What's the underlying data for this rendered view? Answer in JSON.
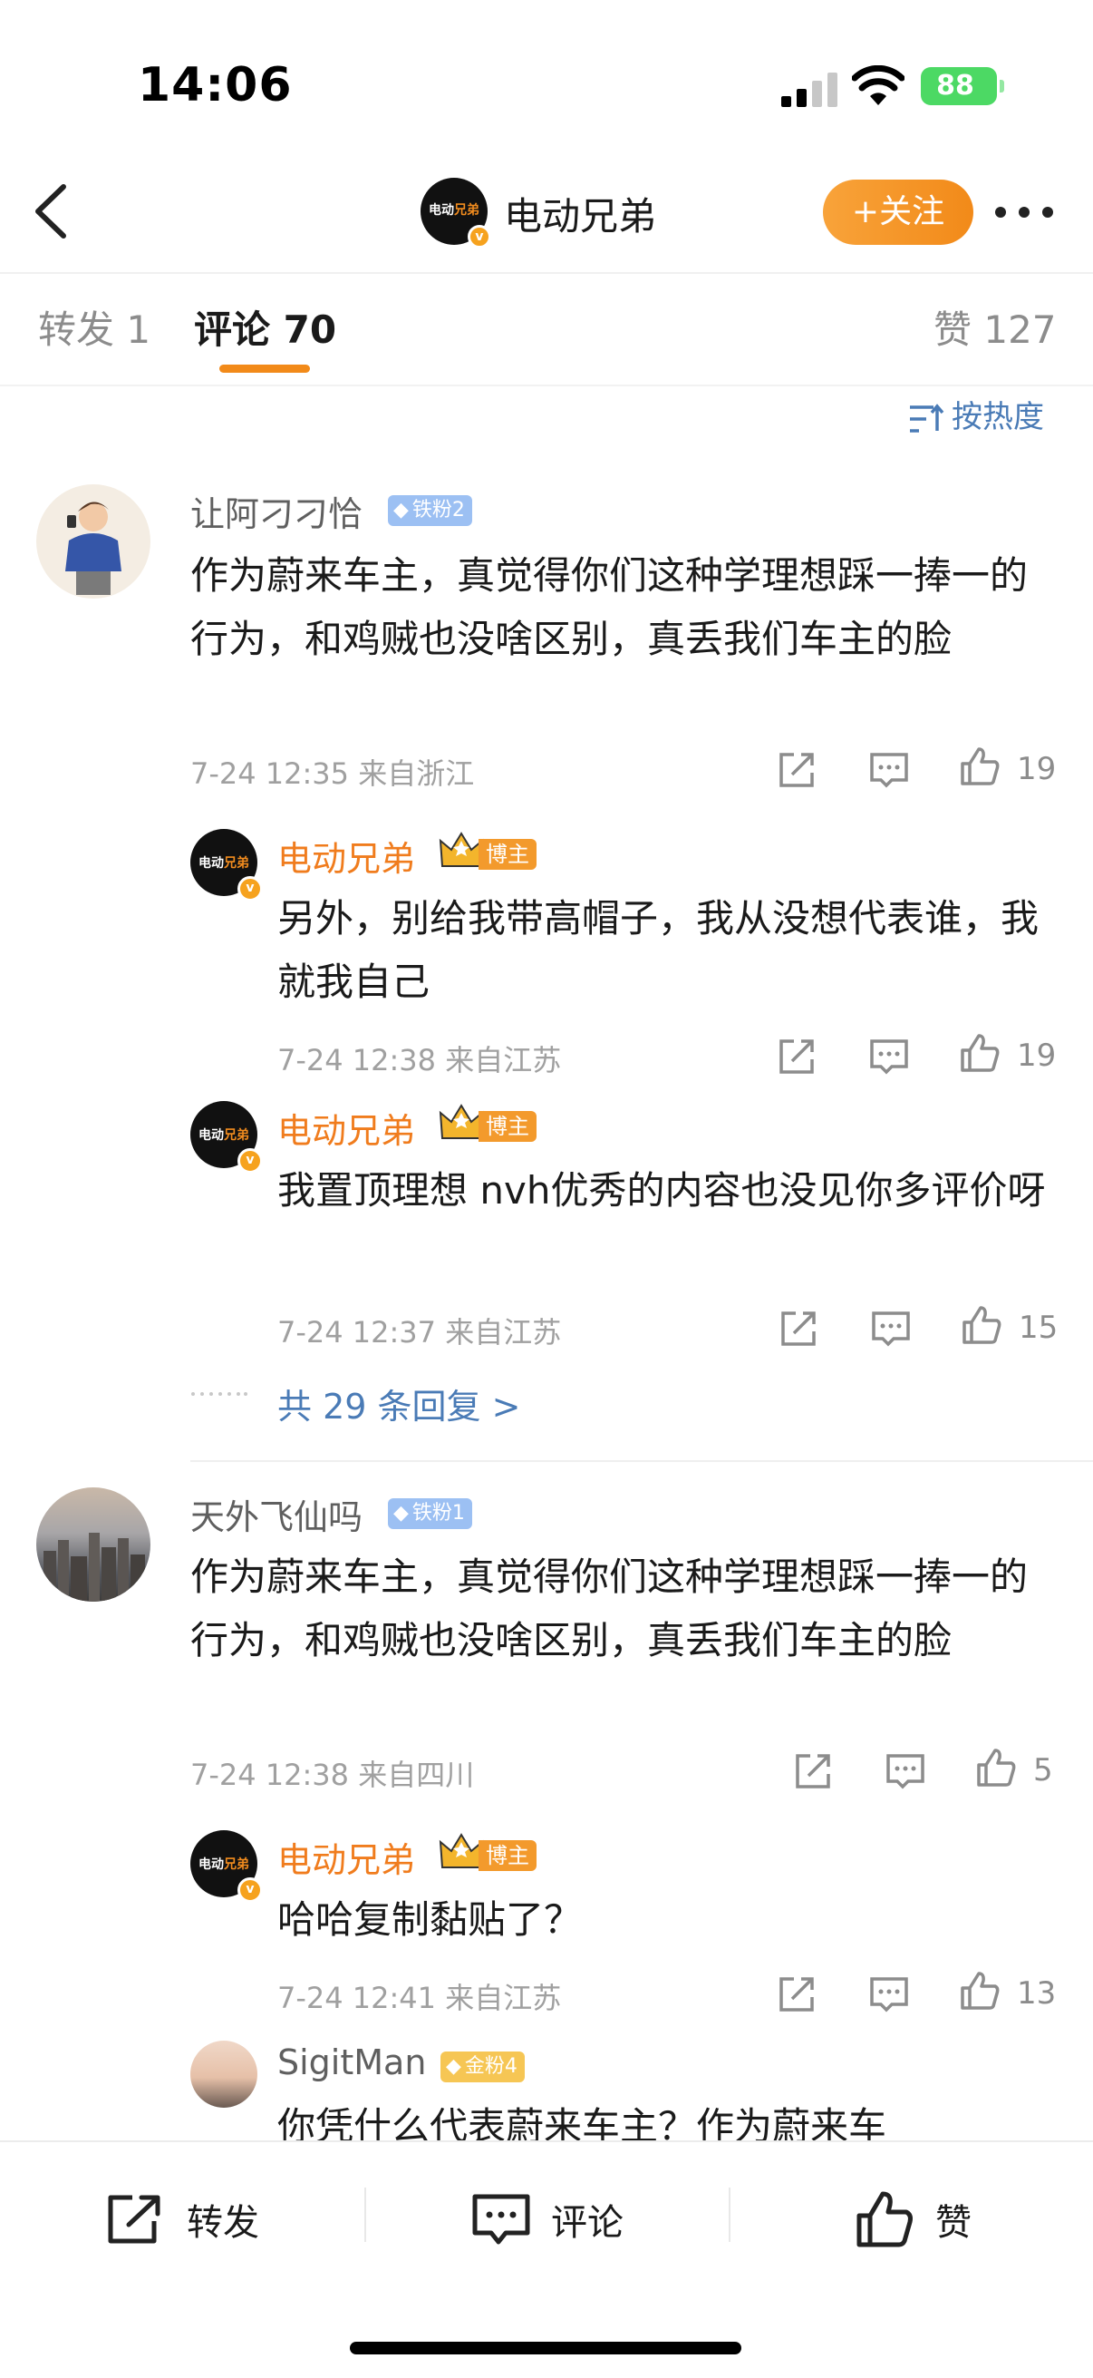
{
  "status_bar": {
    "time": "14:06",
    "battery": "88"
  },
  "nav": {
    "logo_text": "电动",
    "logo_accent": "兄弟",
    "title": "电动兄弟",
    "follow_label": "+关注",
    "verified": "v"
  },
  "tabs": [
    {
      "label": "转发 1"
    },
    {
      "label": "评论 70",
      "active": true
    },
    {
      "label": "赞 127"
    }
  ],
  "sort_label": "按热度",
  "comments": [
    {
      "user": "让阿刁刁恰",
      "badge": "铁粉2",
      "text": "作为蔚来车主，真觉得你们这种学理想踩一捧一的行为，和鸡贼也没啥区别，真丢我们车主的脸",
      "meta": "7-24 12:35 来自浙江",
      "likes": "19",
      "replies": [
        {
          "user": "电动兄弟",
          "tag": "博主",
          "text": "另外，别给我带高帽子，我从没想代表谁，我就我自己",
          "meta": "7-24 12:38 来自江苏",
          "likes": "19"
        },
        {
          "user": "电动兄弟",
          "tag": "博主",
          "text": "我置顶理想 nvh优秀的内容也没见你多评价呀",
          "meta": "7-24 12:37 来自江苏",
          "likes": "15"
        }
      ],
      "more_replies": "共 29 条回复 >"
    },
    {
      "user": "天外飞仙吗",
      "badge": "铁粉1",
      "text": "作为蔚来车主，真觉得你们这种学理想踩一捧一的行为，和鸡贼也没啥区别，真丢我们车主的脸",
      "meta": "7-24 12:38 来自四川",
      "likes": "5",
      "replies": [
        {
          "user": "电动兄弟",
          "tag": "博主",
          "text": "哈哈复制黏贴了？",
          "meta": "7-24 12:41 来自江苏",
          "likes": "13"
        },
        {
          "user": "SigitMan",
          "badge": "金粉4",
          "text": "你凭什么代表蔚来车主？作为蔚来车"
        }
      ]
    }
  ],
  "bottom_bar": {
    "repost": "转发",
    "comment": "评论",
    "like": "赞"
  },
  "colors": {
    "accent": "#f28a19",
    "link": "#4a7bb6",
    "fan_badge": "#9cc0f3",
    "gold_badge": "#f6c654"
  }
}
